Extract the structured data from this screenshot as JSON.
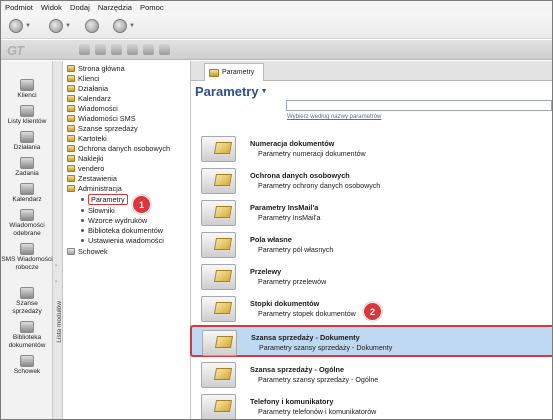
{
  "menu": [
    "Podmiot",
    "Widok",
    "Dodaj",
    "Narzędzia",
    "Pomoc"
  ],
  "logo": "GT",
  "quicknav": [
    {
      "label": "Klienci",
      "icon": "clients-icon"
    },
    {
      "label": "Listy klientów",
      "icon": "client-lists-icon"
    },
    {
      "label": "Działania",
      "icon": "actions-icon"
    },
    {
      "label": "Zadania",
      "icon": "tasks-icon"
    },
    {
      "label": "Kalendarz",
      "icon": "calendar-icon"
    },
    {
      "label": "Wiadomości odebrane",
      "icon": "messages-icon"
    },
    {
      "label": "SMS Wiadomości robocze",
      "icon": "sms-icon"
    },
    {
      "label": "Szanse sprzedaży",
      "icon": "sales-icon"
    },
    {
      "label": "Biblioteka dokumentów",
      "icon": "library-icon"
    },
    {
      "label": "Schowek",
      "icon": "clipboard-icon"
    }
  ],
  "modules_label": "Lista modułów",
  "tree": [
    "Strona główna",
    "Klienci",
    "Działania",
    "Kalendarz",
    "Wiadomości",
    "Wiadomości SMS",
    "Szanse sprzedaży",
    "Kartoteki",
    "Ochrona danych osobowych",
    "Naklejki",
    "vendero",
    "Zestawienia",
    "Administracja"
  ],
  "tree_sub": [
    "Parametry",
    "Słowniki",
    "Wzorce wydruków",
    "Biblioteka dokumentów",
    "Ustawienia wiadomości"
  ],
  "tree_last": "Schowek",
  "badges": [
    "1",
    "2"
  ],
  "tab_label": "Parametry",
  "page_title": "Parametry",
  "search": {
    "value": "",
    "hint": "Wybierz według nazwy parametrów"
  },
  "rows": [
    {
      "title": "Numeracja dokumentów",
      "desc": "Parametry numeracji dokumentów"
    },
    {
      "title": "Ochrona danych osobowych",
      "desc": "Parametry ochrony danych osobowych"
    },
    {
      "title": "Parametry InsMail'a",
      "desc": "Parametry InsMail'a"
    },
    {
      "title": "Pola własne",
      "desc": "Parametry pól własnych"
    },
    {
      "title": "Przelewy",
      "desc": "Parametry przelewów"
    },
    {
      "title": "Stopki dokumentów",
      "desc": "Parametry stopek dokumentów"
    },
    {
      "title": "Szansa sprzedaży - Dokumenty",
      "desc": "Parametry szansy sprzedaży - Dokumenty"
    },
    {
      "title": "Szansa sprzedaży - Ogólne",
      "desc": "Parametry szansy sprzedaży - Ogólne"
    },
    {
      "title": "Telefony i komunikatory",
      "desc": "Parametry telefonów i komunikatorów"
    }
  ]
}
